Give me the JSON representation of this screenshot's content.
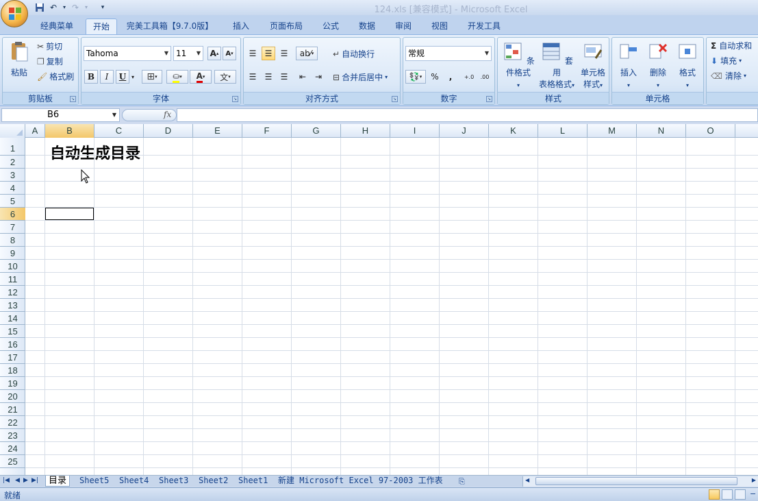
{
  "titlebar": {
    "title": "124.xls  [兼容模式] - Microsoft Excel"
  },
  "tabs": [
    {
      "label": "经典菜单"
    },
    {
      "label": "开始"
    },
    {
      "label": "完美工具箱【9.7.0版】"
    },
    {
      "label": "插入"
    },
    {
      "label": "页面布局"
    },
    {
      "label": "公式"
    },
    {
      "label": "数据"
    },
    {
      "label": "审阅"
    },
    {
      "label": "视图"
    },
    {
      "label": "开发工具"
    }
  ],
  "ribbon": {
    "clipboard": {
      "paste": "粘贴",
      "cut": "剪切",
      "copy": "复制",
      "format_painter": "格式刷",
      "label": "剪贴板"
    },
    "font": {
      "name": "Tahoma",
      "size": "11",
      "bold": "B",
      "italic": "I",
      "underline": "U",
      "label": "字体"
    },
    "alignment": {
      "wrap": "自动换行",
      "merge": "合并后居中",
      "label": "对齐方式"
    },
    "number": {
      "format": "常规",
      "percent": "%",
      "comma": ",",
      "label": "数字"
    },
    "styles": {
      "conditional": "条件格式",
      "table_format_1": "套用",
      "table_format_2": "表格格式",
      "cell_style_1": "单元格",
      "cell_style_2": "样式",
      "label": "样式"
    },
    "cells": {
      "insert": "插入",
      "delete": "删除",
      "format": "格式",
      "label": "单元格"
    },
    "editing": {
      "autosum": "自动求和",
      "fill": "填充",
      "clear": "清除"
    }
  },
  "formula_bar": {
    "name_box": "B6",
    "fx": "fx",
    "formula": ""
  },
  "grid": {
    "columns": [
      "A",
      "B",
      "C",
      "D",
      "E",
      "F",
      "G",
      "H",
      "I",
      "J",
      "K",
      "L",
      "M",
      "N",
      "O"
    ],
    "rows": [
      "1",
      "2",
      "3",
      "4",
      "5",
      "6",
      "7",
      "8",
      "9",
      "10",
      "11",
      "12",
      "13",
      "14",
      "15",
      "16",
      "17",
      "18",
      "19",
      "20",
      "21",
      "22",
      "23",
      "24",
      "25"
    ],
    "selected_cell": "B6",
    "b1_text": "自动生成目录"
  },
  "sheet_tabs": [
    {
      "label": "目录",
      "active": true
    },
    {
      "label": "Sheet5"
    },
    {
      "label": "Sheet4"
    },
    {
      "label": "Sheet3"
    },
    {
      "label": "Sheet2"
    },
    {
      "label": "Sheet1"
    },
    {
      "label": "新建 Microsoft Excel 97-2003 工作表"
    }
  ],
  "status": {
    "text": "就绪"
  }
}
